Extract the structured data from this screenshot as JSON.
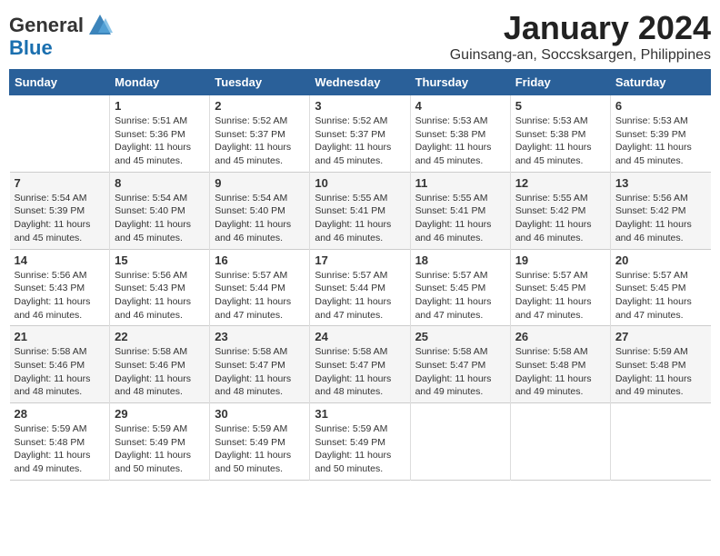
{
  "logo": {
    "general": "General",
    "blue": "Blue"
  },
  "title": "January 2024",
  "subtitle": "Guinsang-an, Soccsksargen, Philippines",
  "days_header": [
    "Sunday",
    "Monday",
    "Tuesday",
    "Wednesday",
    "Thursday",
    "Friday",
    "Saturday"
  ],
  "weeks": [
    [
      {
        "num": "",
        "info": ""
      },
      {
        "num": "1",
        "info": "Sunrise: 5:51 AM\nSunset: 5:36 PM\nDaylight: 11 hours\nand 45 minutes."
      },
      {
        "num": "2",
        "info": "Sunrise: 5:52 AM\nSunset: 5:37 PM\nDaylight: 11 hours\nand 45 minutes."
      },
      {
        "num": "3",
        "info": "Sunrise: 5:52 AM\nSunset: 5:37 PM\nDaylight: 11 hours\nand 45 minutes."
      },
      {
        "num": "4",
        "info": "Sunrise: 5:53 AM\nSunset: 5:38 PM\nDaylight: 11 hours\nand 45 minutes."
      },
      {
        "num": "5",
        "info": "Sunrise: 5:53 AM\nSunset: 5:38 PM\nDaylight: 11 hours\nand 45 minutes."
      },
      {
        "num": "6",
        "info": "Sunrise: 5:53 AM\nSunset: 5:39 PM\nDaylight: 11 hours\nand 45 minutes."
      }
    ],
    [
      {
        "num": "7",
        "info": "Sunrise: 5:54 AM\nSunset: 5:39 PM\nDaylight: 11 hours\nand 45 minutes."
      },
      {
        "num": "8",
        "info": "Sunrise: 5:54 AM\nSunset: 5:40 PM\nDaylight: 11 hours\nand 45 minutes."
      },
      {
        "num": "9",
        "info": "Sunrise: 5:54 AM\nSunset: 5:40 PM\nDaylight: 11 hours\nand 46 minutes."
      },
      {
        "num": "10",
        "info": "Sunrise: 5:55 AM\nSunset: 5:41 PM\nDaylight: 11 hours\nand 46 minutes."
      },
      {
        "num": "11",
        "info": "Sunrise: 5:55 AM\nSunset: 5:41 PM\nDaylight: 11 hours\nand 46 minutes."
      },
      {
        "num": "12",
        "info": "Sunrise: 5:55 AM\nSunset: 5:42 PM\nDaylight: 11 hours\nand 46 minutes."
      },
      {
        "num": "13",
        "info": "Sunrise: 5:56 AM\nSunset: 5:42 PM\nDaylight: 11 hours\nand 46 minutes."
      }
    ],
    [
      {
        "num": "14",
        "info": "Sunrise: 5:56 AM\nSunset: 5:43 PM\nDaylight: 11 hours\nand 46 minutes."
      },
      {
        "num": "15",
        "info": "Sunrise: 5:56 AM\nSunset: 5:43 PM\nDaylight: 11 hours\nand 46 minutes."
      },
      {
        "num": "16",
        "info": "Sunrise: 5:57 AM\nSunset: 5:44 PM\nDaylight: 11 hours\nand 47 minutes."
      },
      {
        "num": "17",
        "info": "Sunrise: 5:57 AM\nSunset: 5:44 PM\nDaylight: 11 hours\nand 47 minutes."
      },
      {
        "num": "18",
        "info": "Sunrise: 5:57 AM\nSunset: 5:45 PM\nDaylight: 11 hours\nand 47 minutes."
      },
      {
        "num": "19",
        "info": "Sunrise: 5:57 AM\nSunset: 5:45 PM\nDaylight: 11 hours\nand 47 minutes."
      },
      {
        "num": "20",
        "info": "Sunrise: 5:57 AM\nSunset: 5:45 PM\nDaylight: 11 hours\nand 47 minutes."
      }
    ],
    [
      {
        "num": "21",
        "info": "Sunrise: 5:58 AM\nSunset: 5:46 PM\nDaylight: 11 hours\nand 48 minutes."
      },
      {
        "num": "22",
        "info": "Sunrise: 5:58 AM\nSunset: 5:46 PM\nDaylight: 11 hours\nand 48 minutes."
      },
      {
        "num": "23",
        "info": "Sunrise: 5:58 AM\nSunset: 5:47 PM\nDaylight: 11 hours\nand 48 minutes."
      },
      {
        "num": "24",
        "info": "Sunrise: 5:58 AM\nSunset: 5:47 PM\nDaylight: 11 hours\nand 48 minutes."
      },
      {
        "num": "25",
        "info": "Sunrise: 5:58 AM\nSunset: 5:47 PM\nDaylight: 11 hours\nand 49 minutes."
      },
      {
        "num": "26",
        "info": "Sunrise: 5:58 AM\nSunset: 5:48 PM\nDaylight: 11 hours\nand 49 minutes."
      },
      {
        "num": "27",
        "info": "Sunrise: 5:59 AM\nSunset: 5:48 PM\nDaylight: 11 hours\nand 49 minutes."
      }
    ],
    [
      {
        "num": "28",
        "info": "Sunrise: 5:59 AM\nSunset: 5:48 PM\nDaylight: 11 hours\nand 49 minutes."
      },
      {
        "num": "29",
        "info": "Sunrise: 5:59 AM\nSunset: 5:49 PM\nDaylight: 11 hours\nand 50 minutes."
      },
      {
        "num": "30",
        "info": "Sunrise: 5:59 AM\nSunset: 5:49 PM\nDaylight: 11 hours\nand 50 minutes."
      },
      {
        "num": "31",
        "info": "Sunrise: 5:59 AM\nSunset: 5:49 PM\nDaylight: 11 hours\nand 50 minutes."
      },
      {
        "num": "",
        "info": ""
      },
      {
        "num": "",
        "info": ""
      },
      {
        "num": "",
        "info": ""
      }
    ]
  ]
}
